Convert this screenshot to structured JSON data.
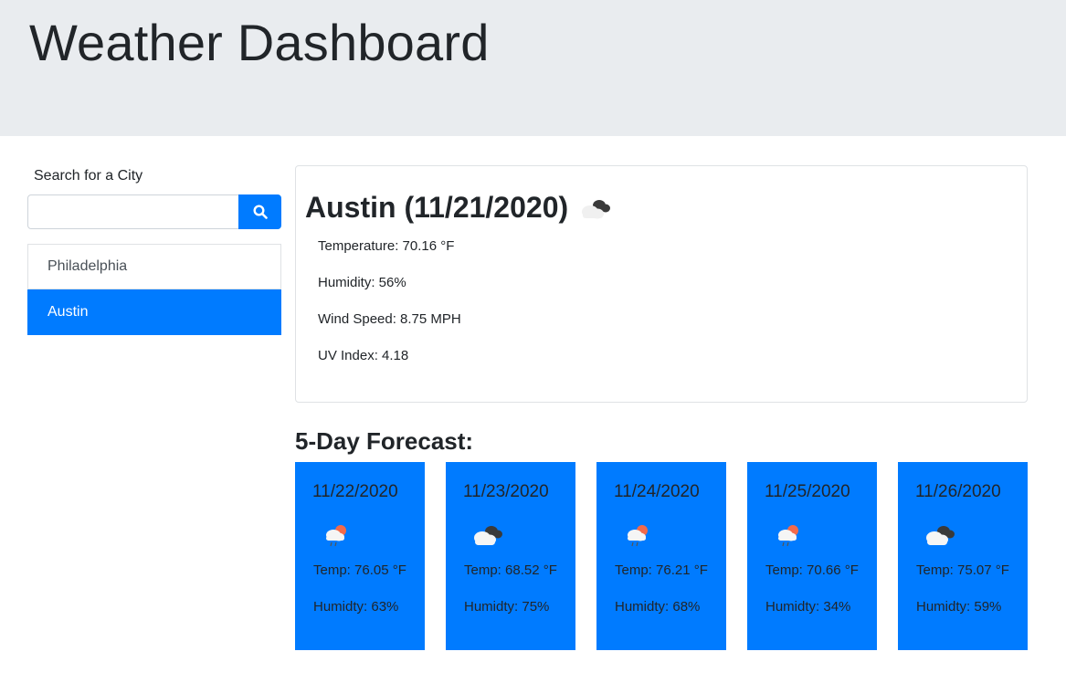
{
  "header": {
    "title": "Weather Dashboard"
  },
  "search": {
    "label": "Search for a City",
    "value": "",
    "placeholder": ""
  },
  "cities": [
    "Philadelphia",
    "Austin"
  ],
  "active_city": "Austin",
  "current": {
    "title": "Austin (11/21/2020)",
    "icon": "broken-clouds-icon",
    "temperature": "Temperature: 70.16 °F",
    "humidity": "Humidity: 56%",
    "wind": "Wind Speed: 8.75 MPH",
    "uv": "UV Index: 4.18"
  },
  "forecast": {
    "heading": "5-Day Forecast:",
    "days": [
      {
        "date": "11/22/2020",
        "icon": "rain-sun-icon",
        "temp": "Temp: 76.05 °F",
        "hum": "Humidty: 63%"
      },
      {
        "date": "11/23/2020",
        "icon": "broken-clouds-icon",
        "temp": "Temp: 68.52 °F",
        "hum": "Humidty: 75%"
      },
      {
        "date": "11/24/2020",
        "icon": "rain-sun-icon",
        "temp": "Temp: 76.21 °F",
        "hum": "Humidty: 68%"
      },
      {
        "date": "11/25/2020",
        "icon": "rain-sun-icon",
        "temp": "Temp: 70.66 °F",
        "hum": "Humidty: 34%"
      },
      {
        "date": "11/26/2020",
        "icon": "broken-clouds-icon",
        "temp": "Temp: 75.07 °F",
        "hum": "Humidty: 59%"
      }
    ]
  },
  "colors": {
    "primary": "#007bff",
    "jumbotron": "#e9ecef"
  }
}
